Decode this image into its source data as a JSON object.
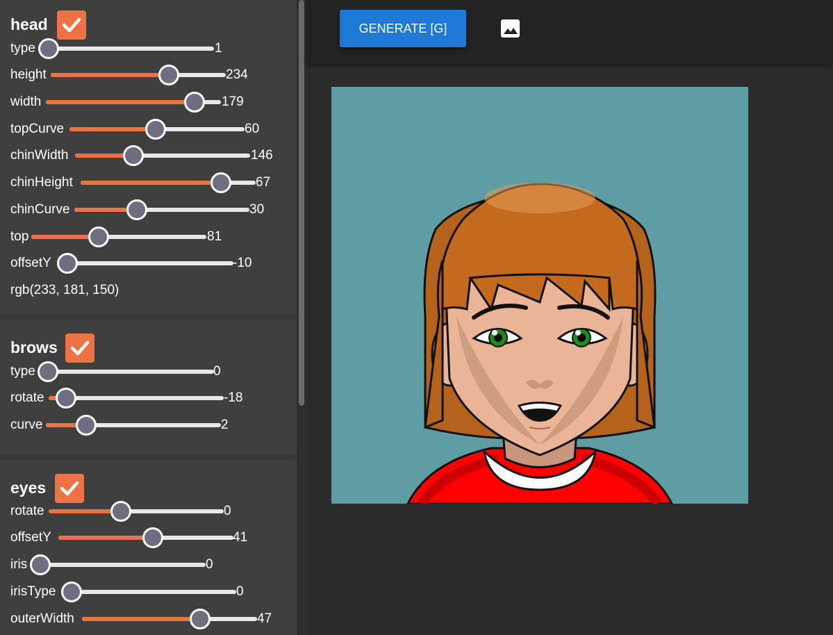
{
  "toolbar": {
    "generate_label": "GENERATE [G]",
    "image_icon": "image-icon"
  },
  "groups": {
    "head": {
      "title": "head",
      "checked": true,
      "color_text": "rgb(233, 181, 150)",
      "sliders": [
        {
          "label": "type",
          "value": "1",
          "level": 0.0
        },
        {
          "label": "height",
          "value": "234",
          "level": 0.68
        },
        {
          "label": "width",
          "value": "179",
          "level": 0.86
        },
        {
          "label": "topCurve",
          "value": "60",
          "level": 0.5
        },
        {
          "label": "chinWidth",
          "value": "146",
          "level": 0.33
        },
        {
          "label": "chinHeight",
          "value": "67",
          "level": 0.82
        },
        {
          "label": "chinCurve",
          "value": "30",
          "level": 0.36
        },
        {
          "label": "top",
          "value": "81",
          "level": 0.38
        },
        {
          "label": "offsetY",
          "value": "-10",
          "level": 0.0
        }
      ]
    },
    "brows": {
      "title": "brows",
      "checked": true,
      "sliders": [
        {
          "label": "type",
          "value": "0",
          "level": 0.0
        },
        {
          "label": "rotate",
          "value": "-18",
          "level": 0.08
        },
        {
          "label": "curve",
          "value": "2",
          "level": 0.24
        }
      ]
    },
    "eyes": {
      "title": "eyes",
      "checked": true,
      "sliders": [
        {
          "label": "rotate",
          "value": "0",
          "level": 0.41
        },
        {
          "label": "offsetY",
          "value": "41",
          "level": 0.54
        },
        {
          "label": "iris",
          "value": "0",
          "level": 0.0
        },
        {
          "label": "irisType",
          "value": "0",
          "level": 0.0
        },
        {
          "label": "outerWidth",
          "value": "47",
          "level": 0.68
        }
      ]
    }
  },
  "colors": {
    "accent": "#ee7344",
    "button": "#1e78d6",
    "canvas_bg": "#5e9ea2",
    "skin": "#e9b596",
    "hair": "#c46a1e",
    "shirt": "#ff0000"
  }
}
